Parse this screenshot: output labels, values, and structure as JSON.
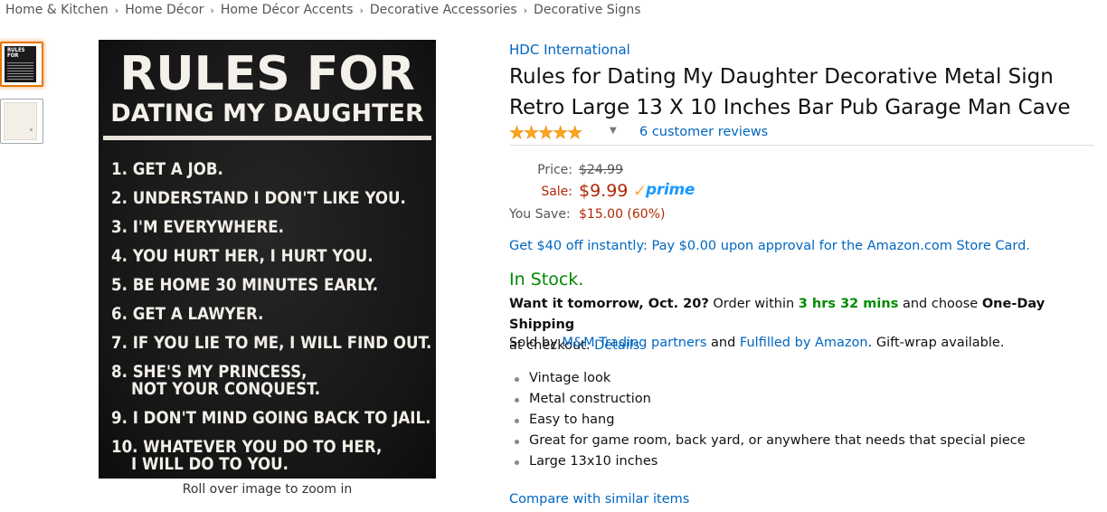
{
  "breadcrumb": [
    "Home & Kitchen",
    "Home Décor",
    "Home Décor Accents",
    "Decorative Accessories",
    "Decorative Signs"
  ],
  "breadcrumb_separator": "›",
  "thumbnails": [
    {
      "mini_title": "RULES FOR"
    },
    {
      "mini_title": ""
    }
  ],
  "sign": {
    "title_line1": "RULES FOR",
    "title_line2": "DATING MY DAUGHTER",
    "rules": [
      "1. GET A JOB.",
      "2. UNDERSTAND I DON'T LIKE YOU.",
      "3. I'M EVERYWHERE.",
      "4. YOU HURT HER, I HURT YOU.",
      "5. BE HOME 30 MINUTES EARLY.",
      "6. GET A LAWYER.",
      "7. IF YOU LIE TO ME, I WILL FIND OUT.",
      "8. SHE'S MY PRINCESS,",
      "NOT YOUR CONQUEST.",
      "9. I DON'T MIND GOING BACK TO JAIL.",
      "10. WHATEVER YOU DO TO HER,",
      "I WILL DO TO YOU."
    ]
  },
  "zoom_hint": "Roll over image to zoom in",
  "product": {
    "brand": "HDC International",
    "title": "Rules for Dating My Daughter Decorative Metal Sign Retro Large 13 X 10 Inches Bar Pub Garage Man Cave",
    "stars": "★★★★★",
    "rating": 5,
    "reviews_link": "6 customer reviews"
  },
  "pricing": {
    "list_label": "Price:",
    "list_price": "$24.99",
    "sale_label": "Sale:",
    "sale_price": "$9.99",
    "prime_check": "✓",
    "prime_label": "prime",
    "save_label": "You Save:",
    "save_value": "$15.00 (60%)"
  },
  "promo": "Get $40 off instantly: Pay $0.00 upon approval for the Amazon.com Store Card.",
  "stock": "In Stock.",
  "delivery": {
    "bold_lead": "Want it tomorrow, Oct. 20?",
    "order_within": "Order within",
    "time_left": "3 hrs 32 mins",
    "and_choose": "and choose",
    "shipping": "One-Day Shipping",
    "at_checkout": "at checkout.",
    "details_link": "Details"
  },
  "sold_by": {
    "prefix": "Sold by",
    "seller": "M&M Trading partners",
    "and": "and",
    "fulfilled": "Fulfilled by Amazon",
    "suffix": ". Gift-wrap available."
  },
  "features": [
    "Vintage look",
    "Metal construction",
    "Easy to hang",
    "Great for game room, back yard, or anywhere that needs that special piece",
    "Large 13x10 inches"
  ],
  "compare_link": "Compare with similar items",
  "colors": {
    "link": "#0066c0",
    "price": "#b12704",
    "stock": "#008a00",
    "star": "#ffa41c",
    "prime": "#1a98ff"
  }
}
